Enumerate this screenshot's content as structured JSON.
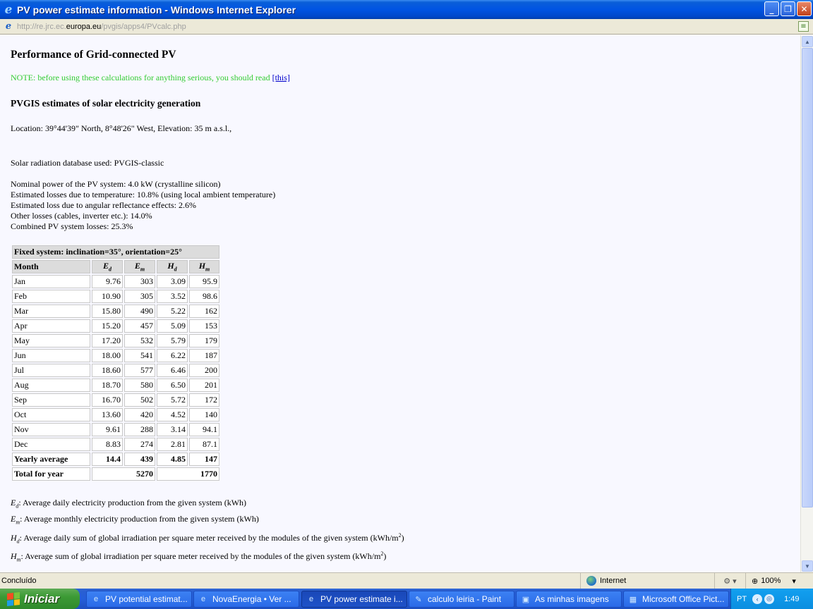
{
  "window": {
    "title": "PV power estimate information - Windows Internet Explorer",
    "url_prefix": "http://re.jrc.ec.",
    "url_domain": "europa.eu",
    "url_suffix": "/pvgis/apps4/PVcalc.php"
  },
  "page": {
    "title": "Performance of Grid-connected PV",
    "note_text": "NOTE: before using these calculations for anything serious, you should read",
    "note_link": "[this]",
    "subtitle": "PVGIS estimates of solar electricity generation",
    "location": "Location: 39°44'39\" North, 8°48'26\" West, Elevation: 35 m a.s.l.,",
    "database": "Solar radiation database used: PVGIS-classic",
    "params": [
      "Nominal power of the PV system: 4.0 kW (crystalline silicon)",
      "Estimated losses due to temperature: 10.8% (using local ambient temperature)",
      "Estimated loss due to angular reflectance effects: 2.6%",
      "Other losses (cables, inverter etc.): 14.0%",
      "Combined PV system losses: 25.3%"
    ]
  },
  "table": {
    "caption": "Fixed system: inclination=35°, orientation=25°",
    "month_header": "Month",
    "col_letters": [
      "E",
      "E",
      "H",
      "H"
    ],
    "col_subs": [
      "d",
      "m",
      "d",
      "m"
    ],
    "rows": [
      {
        "month": "Jan",
        "ed": "9.76",
        "em": "303",
        "hd": "3.09",
        "hm": "95.9"
      },
      {
        "month": "Feb",
        "ed": "10.90",
        "em": "305",
        "hd": "3.52",
        "hm": "98.6"
      },
      {
        "month": "Mar",
        "ed": "15.80",
        "em": "490",
        "hd": "5.22",
        "hm": "162"
      },
      {
        "month": "Apr",
        "ed": "15.20",
        "em": "457",
        "hd": "5.09",
        "hm": "153"
      },
      {
        "month": "May",
        "ed": "17.20",
        "em": "532",
        "hd": "5.79",
        "hm": "179"
      },
      {
        "month": "Jun",
        "ed": "18.00",
        "em": "541",
        "hd": "6.22",
        "hm": "187"
      },
      {
        "month": "Jul",
        "ed": "18.60",
        "em": "577",
        "hd": "6.46",
        "hm": "200"
      },
      {
        "month": "Aug",
        "ed": "18.70",
        "em": "580",
        "hd": "6.50",
        "hm": "201"
      },
      {
        "month": "Sep",
        "ed": "16.70",
        "em": "502",
        "hd": "5.72",
        "hm": "172"
      },
      {
        "month": "Oct",
        "ed": "13.60",
        "em": "420",
        "hd": "4.52",
        "hm": "140"
      },
      {
        "month": "Nov",
        "ed": "9.61",
        "em": "288",
        "hd": "3.14",
        "hm": "94.1"
      },
      {
        "month": "Dec",
        "ed": "8.83",
        "em": "274",
        "hd": "2.81",
        "hm": "87.1"
      }
    ],
    "yearly_average": {
      "label": "Yearly average",
      "ed": "14.4",
      "em": "439",
      "hd": "4.85",
      "hm": "147"
    },
    "total": {
      "label": "Total for year",
      "e": "5270",
      "h": "1770"
    }
  },
  "legend": [
    {
      "letter": "E",
      "sub": "d",
      "text": ": Average daily electricity production from the given system (kWh)",
      "sup": "",
      "tail": ""
    },
    {
      "letter": "E",
      "sub": "m",
      "text": ": Average monthly electricity production from the given system (kWh)",
      "sup": "",
      "tail": ""
    },
    {
      "letter": "H",
      "sub": "d",
      "text": ": Average daily sum of global irradiation per square meter received by the modules of the given system (kWh/m",
      "sup": "2",
      "tail": ")"
    },
    {
      "letter": "H",
      "sub": "m",
      "text": ": Average sum of global irradiation per square meter received by the modules of the given system (kWh/m",
      "sup": "2",
      "tail": ")"
    }
  ],
  "status": {
    "text": "Concluído",
    "zone": "Internet",
    "zoom": "100%"
  },
  "taskbar": {
    "start": "Iniciar",
    "tasks": [
      "PV potential estimat...",
      "NovaEnergia • Ver ...",
      "PV power estimate i...",
      "calculo leiria - Paint",
      "As minhas imagens",
      "Microsoft Office Pict..."
    ],
    "lang": "PT",
    "clock": "1:49"
  }
}
